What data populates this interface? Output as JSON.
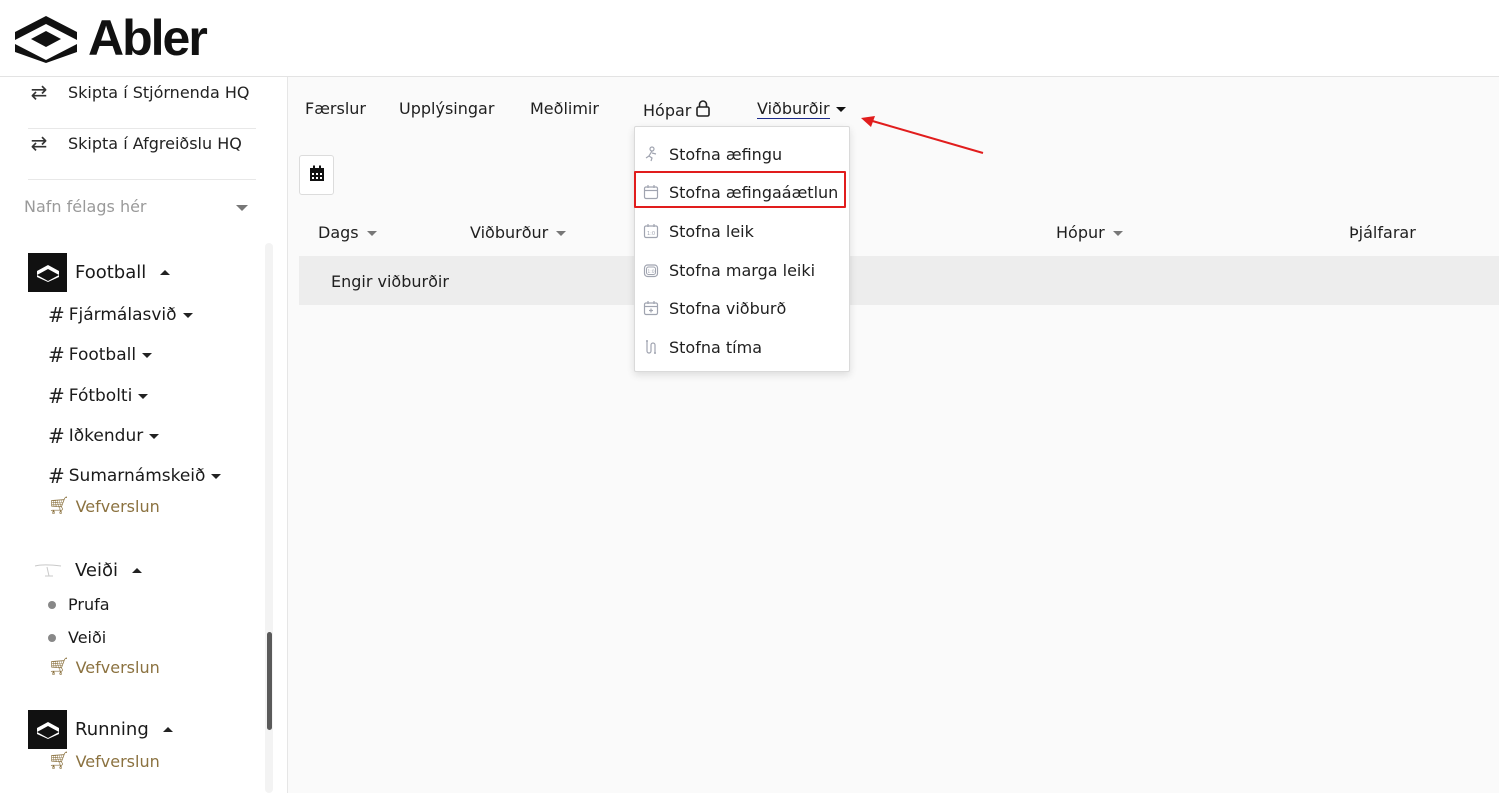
{
  "brand": {
    "name": "Abler"
  },
  "sidebar": {
    "switch_items": [
      {
        "label": "Skipta í Stjórnenda HQ",
        "icon": "swap-arrows-icon"
      },
      {
        "label": "Skipta í Afgreiðslu HQ",
        "icon": "swap-arrows-icon"
      }
    ],
    "club_select": {
      "placeholder": "Nafn félags hér"
    },
    "clubs": [
      {
        "name": "Football",
        "channels": [
          "Fjármálasvið",
          "Football",
          "Fótbolti",
          "Iðkendur",
          "Sumarnámskeið"
        ],
        "shop_label": "Vefverslun"
      },
      {
        "name": "Veiði",
        "items": [
          "Prufa",
          "Veiði"
        ],
        "shop_label": "Vefverslun"
      },
      {
        "name": "Running",
        "shop_label": "Vefverslun"
      }
    ]
  },
  "tabs": [
    {
      "label": "Færslur"
    },
    {
      "label": "Upplýsingar"
    },
    {
      "label": "Meðlimir"
    },
    {
      "label": "Hópar",
      "icon": "lock-icon"
    },
    {
      "label": "Viðburðir",
      "active": true
    }
  ],
  "table": {
    "columns": [
      "Dags",
      "Viðburður",
      "Hópur",
      "Þjálfarar"
    ],
    "empty_text": "Engir viðburðir"
  },
  "dropdown": {
    "items": [
      {
        "label": "Stofna æfingu",
        "icon": "training-icon"
      },
      {
        "label": "Stofna æfingaáætlun",
        "icon": "calendar-plan-icon",
        "highlighted": true
      },
      {
        "label": "Stofna leik",
        "icon": "scoreboard-icon"
      },
      {
        "label": "Stofna marga leiki",
        "icon": "multi-scoreboard-icon"
      },
      {
        "label": "Stofna viðburð",
        "icon": "calendar-add-icon"
      },
      {
        "label": "Stofna tíma",
        "icon": "clock-icon"
      }
    ]
  },
  "colors": {
    "highlight": "#e11d1d",
    "shop": "#8b7240",
    "active_tab_underline": "#1b2a8a"
  }
}
